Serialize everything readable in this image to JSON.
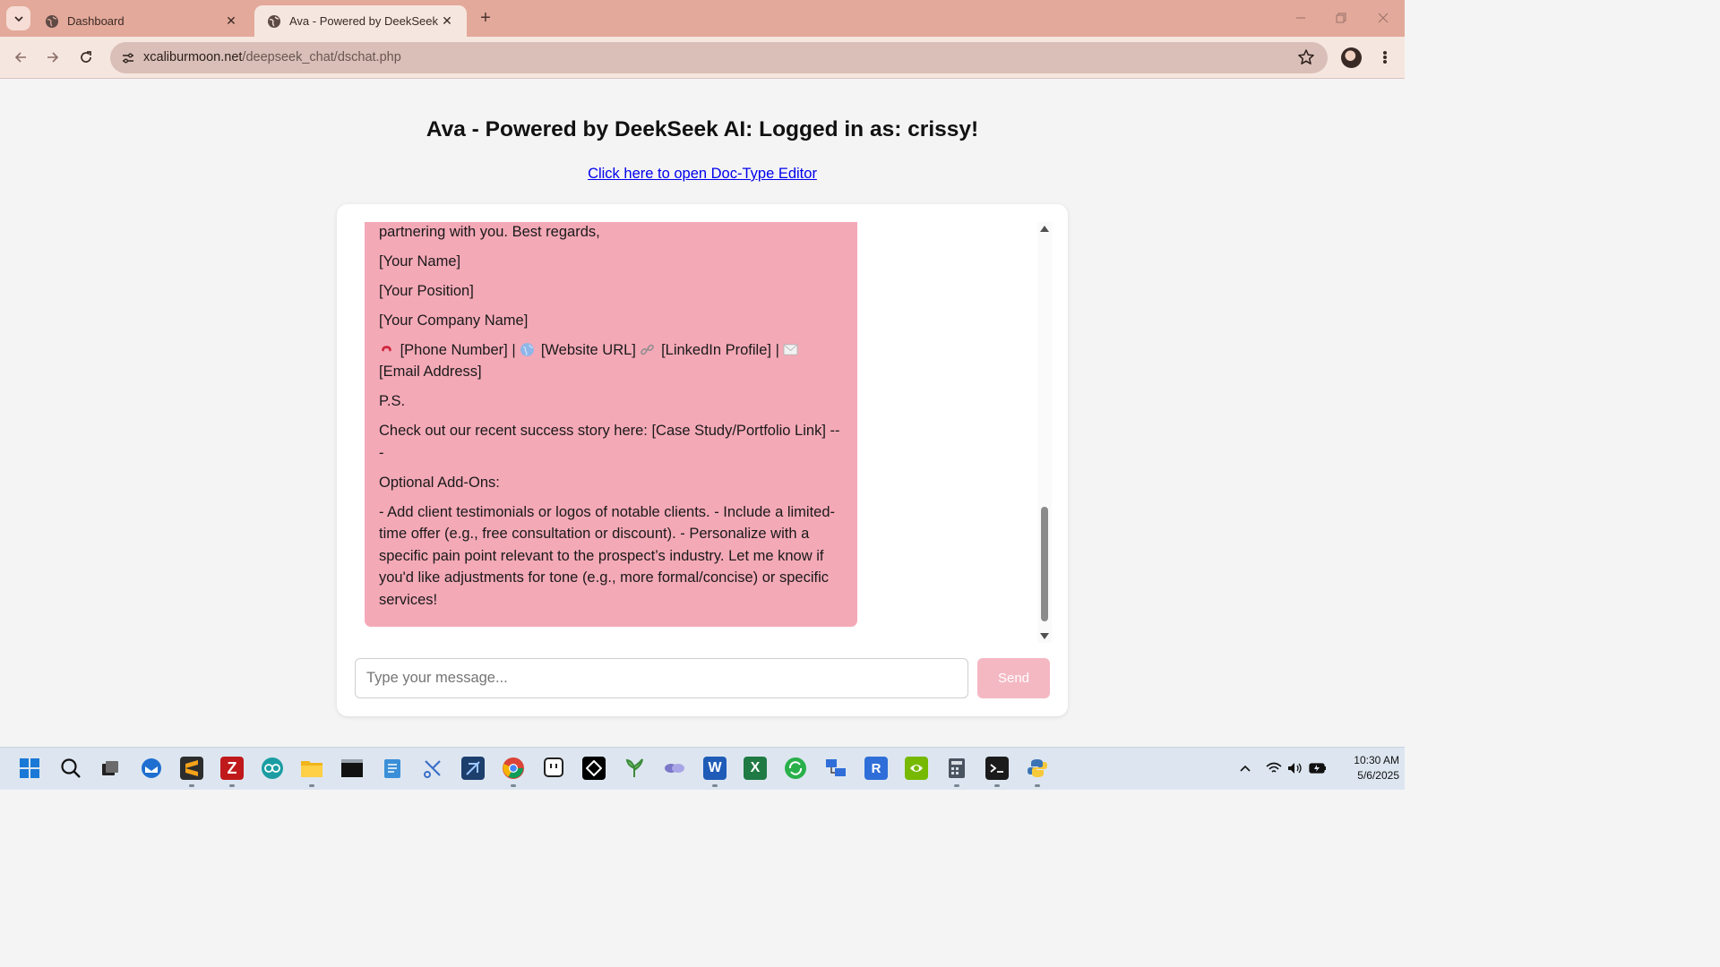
{
  "browser": {
    "tabs": [
      {
        "title": "Dashboard",
        "active": false
      },
      {
        "title": "Ava - Powered by DeekSeek",
        "active": true
      }
    ],
    "url_domain": "xcaliburmoon.net",
    "url_path": "/deepseek_chat/dschat.php"
  },
  "page": {
    "title": "Ava - Powered by DeekSeek AI: Logged in as: crissy!",
    "editor_link": "Click here to open Doc-Type Editor"
  },
  "chat": {
    "message_paragraphs": [
      "[Schedule a Meeting Link] or reply to this email! Looking forward to partnering with you. Best regards,",
      "[Your Name]",
      "[Your Position]",
      "[Your Company Name]",
      "",
      "P.S.",
      "Check out our recent success story here: [Case Study/Portfolio Link] ---",
      "Optional Add-Ons:",
      "- Add client testimonials or logos of notable clients. - Include a limited-time offer (e.g., free consultation or discount). - Personalize with a specific pain point relevant to the prospect’s industry. Let me know if you'd like adjustments for tone (e.g., more formal/concise) or specific services!"
    ],
    "contact_line": {
      "phone": "[Phone Number] |",
      "website": "[Website URL]",
      "linkedin": "[LinkedIn Profile] |",
      "email": "[Email Address]"
    },
    "bubble_color": "#f4a9b7",
    "input_placeholder": "Type your message...",
    "send_label": "Send"
  },
  "taskbar": {
    "time": "10:30 AM",
    "date": "5/6/2025"
  }
}
